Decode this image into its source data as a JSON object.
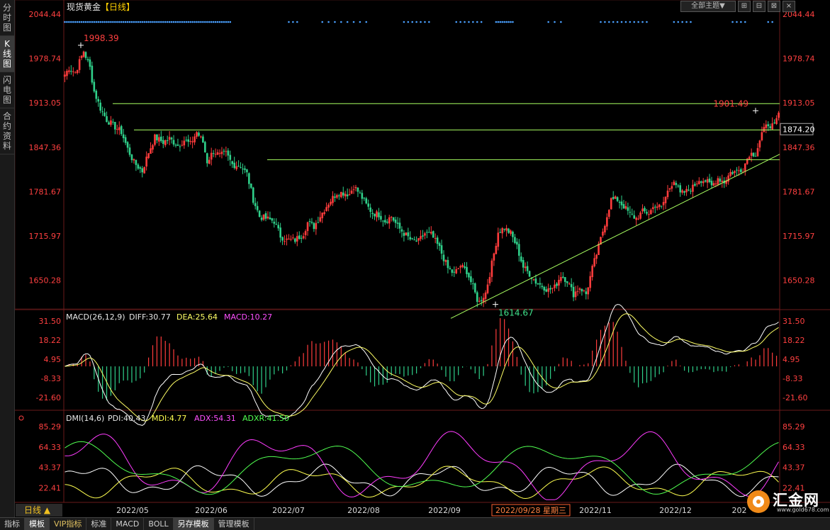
{
  "title": {
    "symbol": "现货黄金",
    "period": "【日线】"
  },
  "side_tabs": [
    {
      "label": "分时图",
      "active": false
    },
    {
      "label": "K线图",
      "active": true
    },
    {
      "label": "闪电图",
      "active": false
    },
    {
      "label": "合约资料",
      "active": false
    }
  ],
  "toolbar": {
    "theme": "全部主题▼",
    "buttons": [
      "⊞",
      "⊟",
      "⊠",
      "×"
    ]
  },
  "bottom_tabs": [
    "指标",
    "模板",
    "VIP指标",
    "标准",
    "MACD",
    "BOLL",
    "另存模板",
    "管理模板"
  ],
  "bottom_active": [
    1,
    6
  ],
  "period_label": "日线 ▲",
  "logo": {
    "name": "汇金网",
    "url": "www.gold678.com"
  },
  "colors": {
    "up": "#ff3c3c",
    "down": "#2fd08a",
    "trendline": "#a8ff60",
    "axis": "#ff4040",
    "diff": "#ffffff",
    "dea": "#ffff66",
    "pdi": "#ffffff",
    "mdi": "#ffff50",
    "adx": "#ff3cff",
    "adxr": "#50ff50"
  },
  "chart_data": [
    {
      "type": "candlestick",
      "title": "现货黄金【日线】",
      "y_ticks": [
        "2044.44",
        "1978.74",
        "1913.05",
        "1847.36",
        "1781.67",
        "1715.97",
        "1650.28"
      ],
      "ylim": [
        1608,
        2044.44
      ],
      "x_ticks": [
        "2022/05",
        "2022/06",
        "2022/07",
        "2022/08",
        "2022/09",
        "2022/11",
        "2022/12",
        "202"
      ],
      "cursor_date": "2022/09/28 星期三",
      "current_price": "1874.20",
      "annotations": [
        {
          "label": "1998.39",
          "value": 1998.39,
          "kind": "high"
        },
        {
          "label": "1614.67",
          "value": 1614.67,
          "kind": "low"
        },
        {
          "label": "1901.49",
          "value": 1901.49,
          "kind": "high"
        }
      ],
      "horizontal_lines": [
        1912,
        1873,
        1829
      ],
      "trendline": {
        "from_price": 1594,
        "to_price": 1837
      },
      "waypoints": [
        [
          0,
          1955
        ],
        [
          2,
          1965
        ],
        [
          5,
          1958
        ],
        [
          9,
          1990
        ],
        [
          12,
          1965
        ],
        [
          14,
          1930
        ],
        [
          17,
          1905
        ],
        [
          20,
          1888
        ],
        [
          23,
          1880
        ],
        [
          27,
          1870
        ],
        [
          30,
          1845
        ],
        [
          33,
          1825
        ],
        [
          37,
          1812
        ],
        [
          40,
          1840
        ],
        [
          43,
          1862
        ],
        [
          47,
          1855
        ],
        [
          50,
          1860
        ],
        [
          54,
          1850
        ],
        [
          57,
          1858
        ],
        [
          60,
          1852
        ],
        [
          63,
          1870
        ],
        [
          66,
          1855
        ],
        [
          68,
          1826
        ],
        [
          71,
          1842
        ],
        [
          74,
          1835
        ],
        [
          77,
          1838
        ],
        [
          80,
          1822
        ],
        [
          84,
          1820
        ],
        [
          87,
          1808
        ],
        [
          90,
          1770
        ],
        [
          93,
          1745
        ],
        [
          96,
          1742
        ],
        [
          100,
          1738
        ],
        [
          103,
          1716
        ],
        [
          106,
          1710
        ],
        [
          110,
          1710
        ],
        [
          114,
          1720
        ],
        [
          116,
          1736
        ],
        [
          119,
          1730
        ],
        [
          122,
          1746
        ],
        [
          126,
          1765
        ],
        [
          130,
          1780
        ],
        [
          133,
          1780
        ],
        [
          136,
          1778
        ],
        [
          138,
          1790
        ],
        [
          141,
          1778
        ],
        [
          144,
          1762
        ],
        [
          147,
          1750
        ],
        [
          150,
          1748
        ],
        [
          153,
          1738
        ],
        [
          156,
          1745
        ],
        [
          159,
          1730
        ],
        [
          162,
          1720
        ],
        [
          166,
          1708
        ],
        [
          169,
          1708
        ],
        [
          172,
          1720
        ],
        [
          175,
          1718
        ],
        [
          179,
          1698
        ],
        [
          183,
          1668
        ],
        [
          186,
          1660
        ],
        [
          189,
          1672
        ],
        [
          192,
          1664
        ],
        [
          195,
          1640
        ],
        [
          197,
          1622
        ],
        [
          198,
          1618
        ],
        [
          201,
          1632
        ],
        [
          203,
          1660
        ],
        [
          205,
          1690
        ],
        [
          207,
          1722
        ],
        [
          210,
          1728
        ],
        [
          213,
          1720
        ],
        [
          216,
          1700
        ],
        [
          219,
          1670
        ],
        [
          222,
          1660
        ],
        [
          225,
          1648
        ],
        [
          228,
          1642
        ],
        [
          231,
          1636
        ],
        [
          234,
          1640
        ],
        [
          237,
          1658
        ],
        [
          240,
          1650
        ],
        [
          243,
          1630
        ],
        [
          246,
          1640
        ],
        [
          249,
          1630
        ],
        [
          252,
          1668
        ],
        [
          255,
          1700
        ],
        [
          258,
          1735
        ],
        [
          261,
          1770
        ],
        [
          264,
          1770
        ],
        [
          267,
          1760
        ],
        [
          270,
          1748
        ],
        [
          273,
          1742
        ],
        [
          276,
          1752
        ],
        [
          279,
          1750
        ],
        [
          282,
          1762
        ],
        [
          285,
          1758
        ],
        [
          288,
          1782
        ],
        [
          291,
          1800
        ],
        [
          294,
          1778
        ],
        [
          297,
          1782
        ],
        [
          300,
          1788
        ],
        [
          303,
          1800
        ],
        [
          306,
          1798
        ],
        [
          309,
          1790
        ],
        [
          312,
          1802
        ],
        [
          315,
          1796
        ],
        [
          318,
          1810
        ],
        [
          321,
          1812
        ],
        [
          324,
          1816
        ],
        [
          327,
          1838
        ],
        [
          330,
          1838
        ],
        [
          333,
          1868
        ],
        [
          336,
          1882
        ],
        [
          339,
          1878
        ],
        [
          341,
          1896
        ]
      ]
    },
    {
      "type": "macd",
      "label": "MACD(26,12,9)",
      "values": {
        "DIFF": "30.77",
        "DEA": "25.64",
        "MACD": "10.27"
      },
      "y_ticks": [
        "31.50",
        "18.22",
        "4.95",
        "-8.33",
        "-21.60"
      ],
      "ylim": [
        -30,
        33
      ]
    },
    {
      "type": "dmi",
      "label": "DMI(14,6)",
      "values": {
        "PDI": "40.43",
        "MDI": "4.77",
        "ADX": "54.31",
        "ADXR": "41.50"
      },
      "y_ticks": [
        "85.29",
        "64.33",
        "43.37",
        "22.41"
      ],
      "ylim": [
        8,
        92
      ]
    }
  ]
}
